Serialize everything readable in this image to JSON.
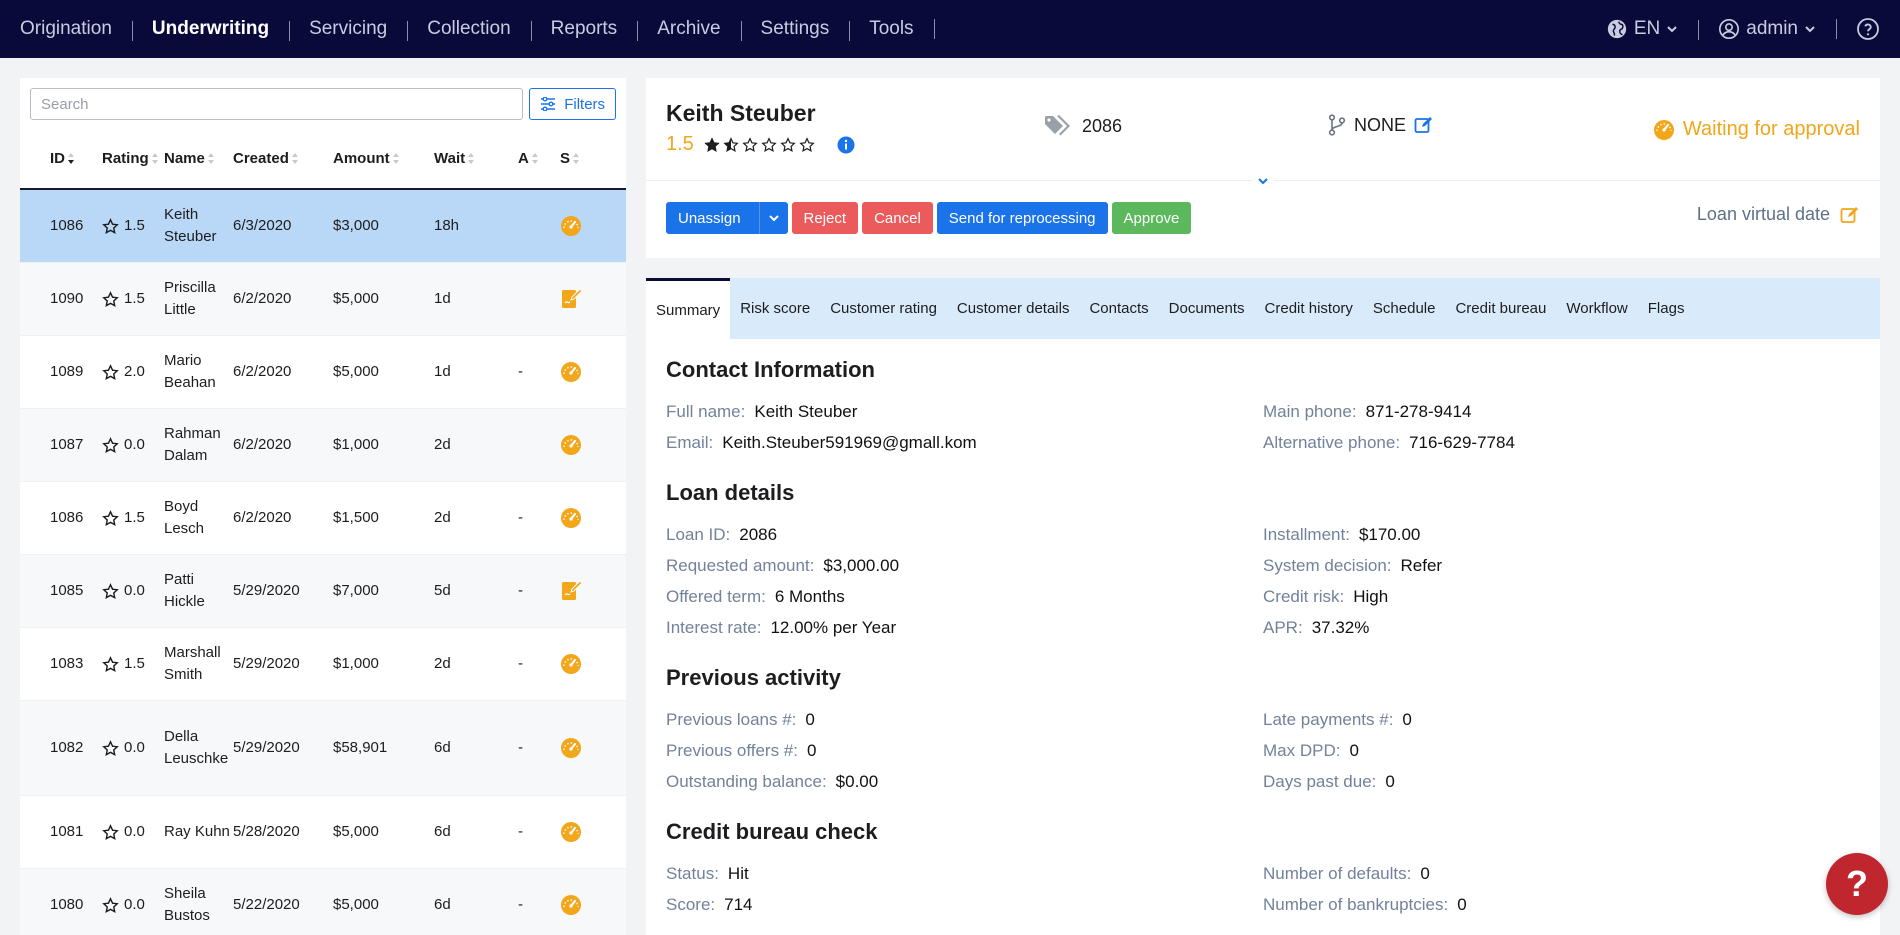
{
  "nav": {
    "items": [
      {
        "label": "Origination",
        "active": false
      },
      {
        "label": "Underwriting",
        "active": true
      },
      {
        "label": "Servicing",
        "active": false
      },
      {
        "label": "Collection",
        "active": false
      },
      {
        "label": "Reports",
        "active": false
      },
      {
        "label": "Archive",
        "active": false
      },
      {
        "label": "Settings",
        "active": false
      },
      {
        "label": "Tools",
        "active": false
      }
    ],
    "language": "EN",
    "user": "admin"
  },
  "list": {
    "search_placeholder": "Search",
    "filters_label": "Filters",
    "columns": [
      "ID",
      "Rating",
      "Name",
      "Created",
      "Amount",
      "Wait",
      "A",
      "S"
    ],
    "rows": [
      {
        "id": "1086",
        "name": "Keith Steuber",
        "rating": "1.5",
        "created": "6/3/2020",
        "amount": "$3,000",
        "wait": "18h",
        "a": "",
        "status": "gauge",
        "selected": true
      },
      {
        "id": "1090",
        "name": "Priscilla Little",
        "rating": "1.5",
        "created": "6/2/2020",
        "amount": "$5,000",
        "wait": "1d",
        "a": "",
        "status": "edit"
      },
      {
        "id": "1089",
        "name": "Mario Beahan",
        "rating": "2.0",
        "created": "6/2/2020",
        "amount": "$5,000",
        "wait": "1d",
        "a": "-",
        "status": "gauge"
      },
      {
        "id": "1087",
        "name": "Rahman Dalam",
        "rating": "0.0",
        "created": "6/2/2020",
        "amount": "$1,000",
        "wait": "2d",
        "a": "",
        "status": "gauge"
      },
      {
        "id": "1086",
        "name": "Boyd Lesch",
        "rating": "1.5",
        "created": "6/2/2020",
        "amount": "$1,500",
        "wait": "2d",
        "a": "-",
        "status": "gauge"
      },
      {
        "id": "1085",
        "name": "Patti Hickle",
        "rating": "0.0",
        "created": "5/29/2020",
        "amount": "$7,000",
        "wait": "5d",
        "a": "-",
        "status": "edit"
      },
      {
        "id": "1083",
        "name": "Marshall Smith",
        "rating": "1.5",
        "created": "5/29/2020",
        "amount": "$1,000",
        "wait": "2d",
        "a": "-",
        "status": "gauge"
      },
      {
        "id": "1082",
        "name": "Della Leuschke",
        "rating": "0.0",
        "created": "5/29/2020",
        "amount": "$58,901",
        "wait": "6d",
        "a": "-",
        "status": "gauge"
      },
      {
        "id": "1081",
        "name": "Ray Kuhn",
        "rating": "0.0",
        "created": "5/28/2020",
        "amount": "$5,000",
        "wait": "6d",
        "a": "-",
        "status": "gauge"
      },
      {
        "id": "1080",
        "name": "Sheila Bustos",
        "rating": "0.0",
        "created": "5/22/2020",
        "amount": "$5,000",
        "wait": "6d",
        "a": "-",
        "status": "gauge"
      }
    ]
  },
  "detail": {
    "name": "Keith Steuber",
    "rating": "1.5",
    "rating_value": 1.5,
    "rating_max": 6,
    "loan_id": "2086",
    "branch": "NONE",
    "status": "Waiting for approval",
    "actions": {
      "unassign": "Unassign",
      "reject": "Reject",
      "cancel": "Cancel",
      "reprocess": "Send for reprocessing",
      "approve": "Approve"
    },
    "virtual_date_label": "Loan virtual date",
    "tabs": [
      "Summary",
      "Risk score",
      "Customer rating",
      "Customer details",
      "Contacts",
      "Documents",
      "Credit history",
      "Schedule",
      "Credit bureau",
      "Workflow",
      "Flags"
    ],
    "sections": [
      {
        "title": "Contact Information",
        "left": [
          {
            "k": "Full name:",
            "v": "Keith Steuber"
          },
          {
            "k": "Email:",
            "v": "Keith.Steuber591969@gmall.kom"
          }
        ],
        "right": [
          {
            "k": "Main phone:",
            "v": "871-278-9414"
          },
          {
            "k": "Alternative phone:",
            "v": "716-629-7784"
          }
        ]
      },
      {
        "title": "Loan details",
        "left": [
          {
            "k": "Loan ID:",
            "v": "2086"
          },
          {
            "k": "Requested amount:",
            "v": "$3,000.00"
          },
          {
            "k": "Offered term:",
            "v": "6 Months"
          },
          {
            "k": "Interest rate:",
            "v": "12.00% per Year"
          }
        ],
        "right": [
          {
            "k": "Installment:",
            "v": "$170.00"
          },
          {
            "k": "System decision:",
            "v": "Refer"
          },
          {
            "k": "Credit risk:",
            "v": "High"
          },
          {
            "k": "APR:",
            "v": "37.32%"
          }
        ]
      },
      {
        "title": "Previous activity",
        "left": [
          {
            "k": "Previous loans #:",
            "v": "0"
          },
          {
            "k": "Previous offers #:",
            "v": "0"
          },
          {
            "k": "Outstanding balance:",
            "v": "$0.00"
          }
        ],
        "right": [
          {
            "k": "Late payments #:",
            "v": "0"
          },
          {
            "k": "Max DPD:",
            "v": "0"
          },
          {
            "k": "Days past due:",
            "v": "0"
          }
        ]
      },
      {
        "title": "Credit bureau check",
        "left": [
          {
            "k": "Status:",
            "v": "Hit"
          },
          {
            "k": "Score:",
            "v": "714"
          }
        ],
        "right": [
          {
            "k": "Number of defaults:",
            "v": "0"
          },
          {
            "k": "Number of bankruptcies:",
            "v": "0"
          }
        ]
      }
    ]
  },
  "help": "?",
  "colors": {
    "nav_bg": "#0a0a3a",
    "accent_blue": "#1a73e8",
    "status_orange": "#f2a61a",
    "reject_red": "#ec5b5b",
    "approve_green": "#5cb85c",
    "selected_row": "#b9d8f7",
    "tabs_bg": "#d9eafb"
  }
}
